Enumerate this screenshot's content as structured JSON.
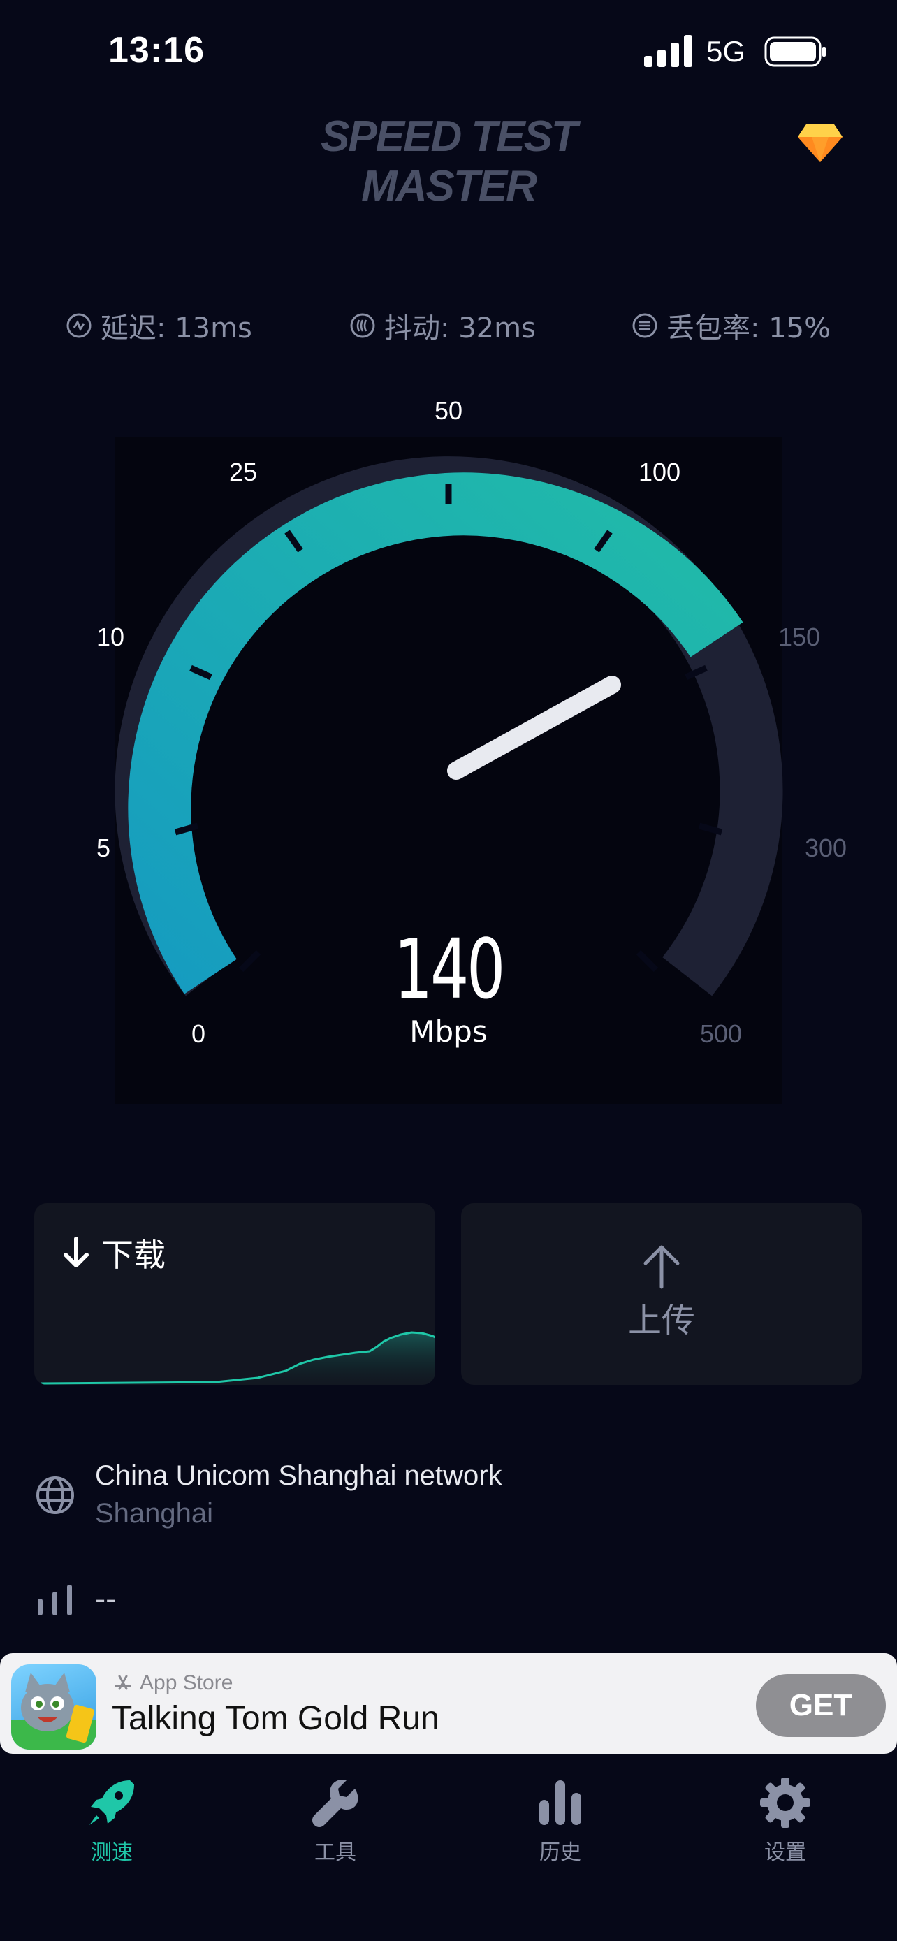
{
  "status_bar": {
    "time": "13:16",
    "network": "5G"
  },
  "header": {
    "logo_text": "SPEED TEST MASTER",
    "premium_icon": "diamond-icon"
  },
  "metrics": {
    "latency": "延迟: 13ms",
    "jitter": "抖动: 32ms",
    "packet_loss": "丢包率: 15%"
  },
  "gauge": {
    "scale_labels": [
      "0",
      "5",
      "10",
      "25",
      "50",
      "100",
      "150",
      "300",
      "500"
    ],
    "current_speed": "140",
    "unit": "Mbps",
    "accent_color": "#1fb7b0"
  },
  "download_card": {
    "label": "下载",
    "accent_color": "#1fc7a8"
  },
  "upload_card": {
    "label": "上传"
  },
  "network_info": {
    "isp": "China Unicom Shanghai network",
    "location": "Shanghai",
    "signal": "--"
  },
  "ad": {
    "store": "App Store",
    "title": "Talking Tom Gold Run",
    "button": "GET"
  },
  "tab_bar": {
    "items": [
      {
        "label": "测速",
        "icon": "rocket-icon",
        "active": true
      },
      {
        "label": "工具",
        "icon": "wrench-icon",
        "active": false
      },
      {
        "label": "历史",
        "icon": "bar-chart-icon",
        "active": false
      },
      {
        "label": "设置",
        "icon": "gear-icon",
        "active": false
      }
    ]
  }
}
